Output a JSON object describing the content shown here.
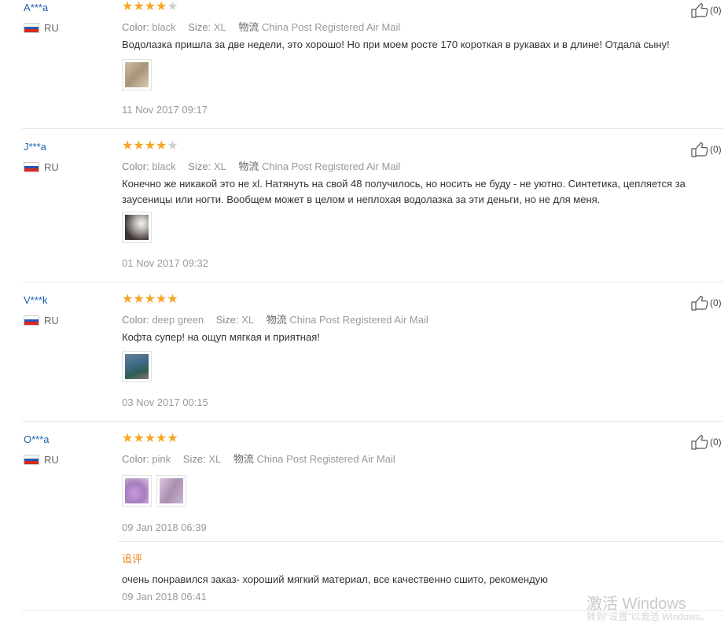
{
  "labels": {
    "color": "Color:",
    "size": "Size:",
    "shipping": "物流",
    "followup": "追评"
  },
  "colors": {
    "star_on": "#f5a623",
    "star_off": "#cfcfcf",
    "username": "#1a5fad",
    "followup_label": "#e8811a",
    "flag_white": "#ffffff",
    "flag_blue": "#2a55b3",
    "flag_red": "#d52b1e"
  },
  "reviews": [
    {
      "user": "A***a",
      "country": "RU",
      "rating": 4,
      "color": "black",
      "size": "XL",
      "shipping": "China Post Registered Air Mail",
      "feedback": "Водолазка пришла за две недели, это хорошо! Но при моем росте 170 короткая в рукавах и в длине! Отдала сыну!",
      "photos": [
        "beige-photo"
      ],
      "date": "11 Nov 2017 09:17",
      "useful": "(0)"
    },
    {
      "user": "J***a",
      "country": "RU",
      "rating": 4,
      "color": "black",
      "size": "XL",
      "shipping": "China Post Registered Air Mail",
      "feedback": "Конечно же никакой это не xl. Натянуть на свой 48 получилось, но носить не буду - не уютно. Синтетика, цепляется за заусеницы или ногти. Вообщем может в целом и неплохая водолазка за эти деньги, но не для меня.",
      "photos": [
        "dark-photo"
      ],
      "date": "01 Nov 2017 09:32",
      "useful": "(0)"
    },
    {
      "user": "V***k",
      "country": "RU",
      "rating": 5,
      "color": "deep green",
      "size": "XL",
      "shipping": "China Post Registered Air Mail",
      "feedback": "Кофта супер! на ощуп мягкая и приятная!",
      "photos": [
        "green-photo"
      ],
      "date": "03 Nov 2017 00:15",
      "useful": "(0)"
    },
    {
      "user": "O***a",
      "country": "RU",
      "rating": 5,
      "color": "pink",
      "size": "XL",
      "shipping": "China Post Registered Air Mail",
      "feedback": "",
      "photos": [
        "pink-photo-1",
        "pink-photo-2"
      ],
      "date": "09 Jan 2018 06:39",
      "useful": "(0)",
      "followup": {
        "text": "очень понравился заказ- хороший мягкий материал, все качественно сшито, рекомендую",
        "date": "09 Jan 2018 06:41"
      }
    }
  ],
  "watermark": {
    "line1": "激活 Windows",
    "line2": "转到\"设置\"以激活 Windows。"
  }
}
